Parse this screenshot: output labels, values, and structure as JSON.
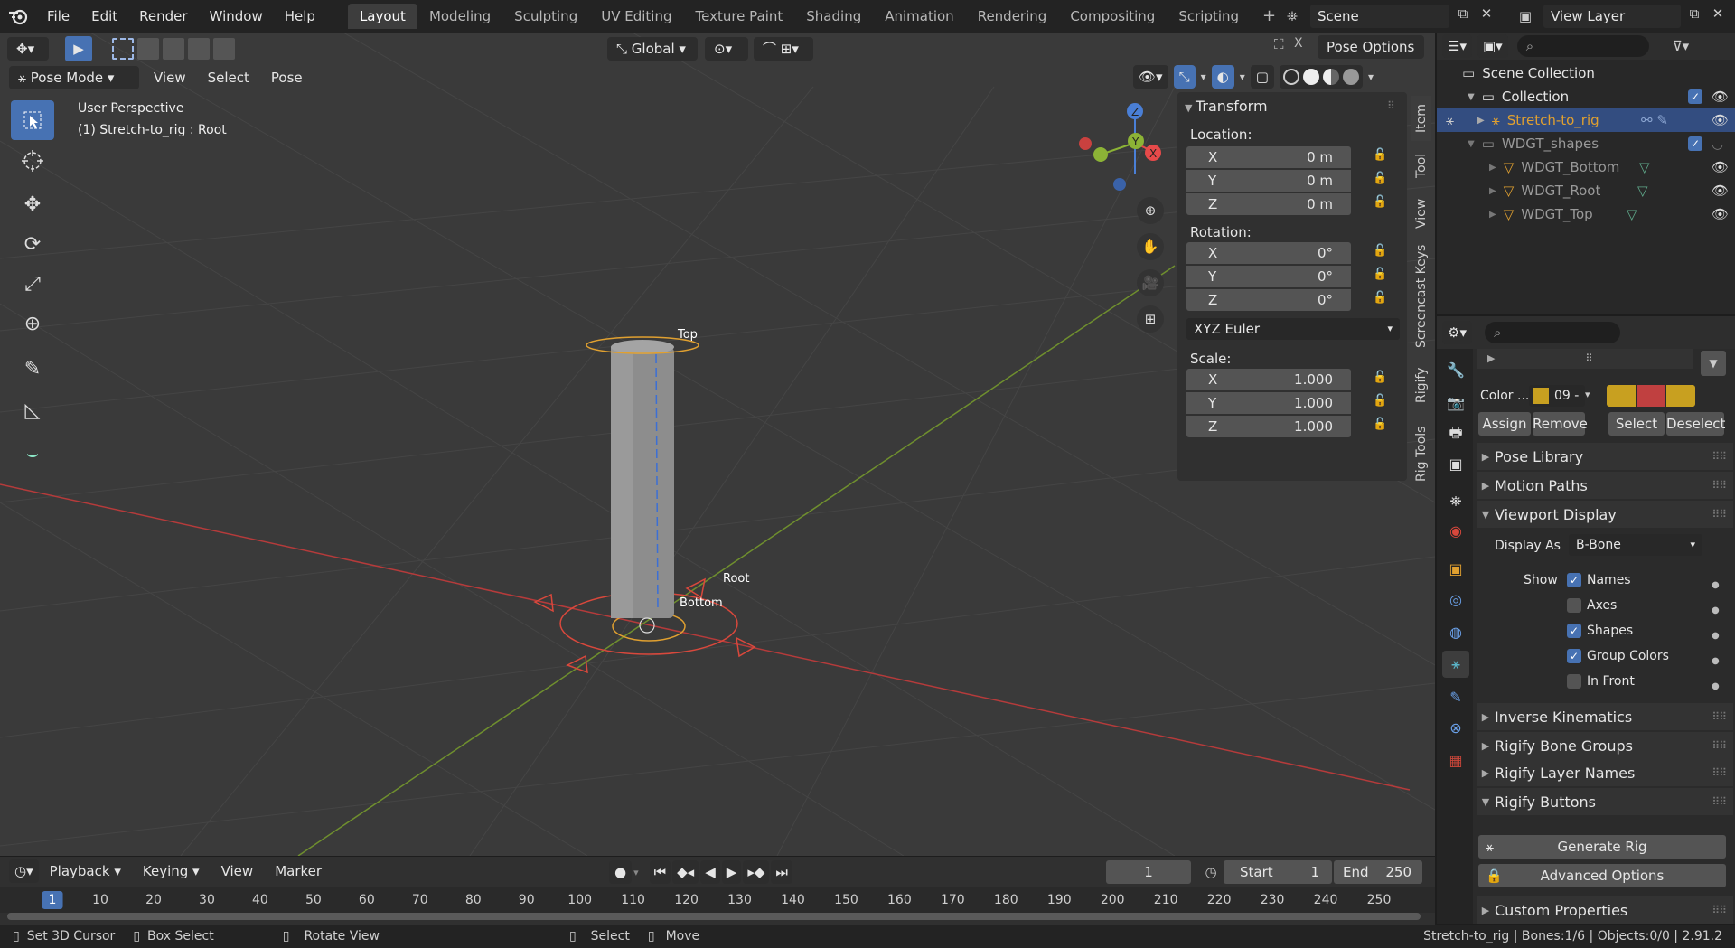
{
  "topbar": {
    "menus": [
      "File",
      "Edit",
      "Render",
      "Window",
      "Help"
    ],
    "workspaces": [
      "Layout",
      "Modeling",
      "Sculpting",
      "UV Editing",
      "Texture Paint",
      "Shading",
      "Animation",
      "Rendering",
      "Compositing",
      "Scripting"
    ],
    "active_workspace": "Layout",
    "scene": "Scene",
    "view_layer": "View Layer"
  },
  "viewport_header": {
    "transform_orientation": "Global",
    "pose_options": "Pose Options",
    "mode": "Pose Mode",
    "menus": [
      "View",
      "Select",
      "Pose"
    ]
  },
  "viewport": {
    "perspective": "User Perspective",
    "object_info": "(1) Stretch-to_rig : Root",
    "bone_labels": {
      "top": "Top",
      "root": "Root",
      "bottom": "Bottom"
    },
    "gizmo_axes": {
      "x": "X",
      "y": "Y",
      "z": "Z"
    },
    "colors": {
      "x_axis": "#e64a4a",
      "y_axis": "#8cb336",
      "z_axis": "#4a7fd6",
      "bg": "#3a3a3a",
      "selected": "#e0a030"
    }
  },
  "npanel": {
    "title": "Transform",
    "location_label": "Location:",
    "location": [
      {
        "axis": "X",
        "value": "0 m"
      },
      {
        "axis": "Y",
        "value": "0 m"
      },
      {
        "axis": "Z",
        "value": "0 m"
      }
    ],
    "rotation_label": "Rotation:",
    "rotation": [
      {
        "axis": "X",
        "value": "0°"
      },
      {
        "axis": "Y",
        "value": "0°"
      },
      {
        "axis": "Z",
        "value": "0°"
      }
    ],
    "rotation_mode": "XYZ Euler",
    "scale_label": "Scale:",
    "scale": [
      {
        "axis": "X",
        "value": "1.000"
      },
      {
        "axis": "Y",
        "value": "1.000"
      },
      {
        "axis": "Z",
        "value": "1.000"
      }
    ],
    "tabs": [
      "Item",
      "Tool",
      "View",
      "Screencast Keys",
      "Rigify",
      "Rig Tools"
    ]
  },
  "outliner": {
    "rows": [
      {
        "label": "Scene Collection"
      },
      {
        "label": "Collection"
      },
      {
        "label": "Stretch-to_rig"
      },
      {
        "label": "WDGT_shapes"
      },
      {
        "label": "WDGT_Bottom"
      },
      {
        "label": "WDGT_Root"
      },
      {
        "label": "WDGT_Top"
      }
    ]
  },
  "properties": {
    "color_label": "Color ...",
    "color_set": "09 - ",
    "assign": "Assign",
    "remove": "Remove",
    "select": "Select",
    "deselect": "Deselect",
    "panels": {
      "pose_library": "Pose Library",
      "motion_paths": "Motion Paths",
      "viewport_display": "Viewport Display",
      "inverse_kinematics": "Inverse Kinematics",
      "rigify_bone_groups": "Rigify Bone Groups",
      "rigify_layer_names": "Rigify Layer Names",
      "rigify_buttons": "Rigify Buttons",
      "custom_properties": "Custom Properties"
    },
    "display_as_label": "Display As",
    "display_as": "B-Bone",
    "show_label": "Show",
    "show_options": [
      {
        "label": "Names",
        "checked": true
      },
      {
        "label": "Axes",
        "checked": false
      },
      {
        "label": "Shapes",
        "checked": true
      },
      {
        "label": "Group Colors",
        "checked": true
      },
      {
        "label": "In Front",
        "checked": false
      }
    ],
    "generate_rig": "Generate Rig",
    "advanced_options": "Advanced Options",
    "swatch_colors": [
      "#c8a020",
      "#c04040",
      "#c8a020"
    ]
  },
  "timeline": {
    "menus": [
      "Playback",
      "Keying",
      "View",
      "Marker"
    ],
    "current_frame": "1",
    "start_label": "Start",
    "start": "1",
    "end_label": "End",
    "end": "250",
    "ticks": [
      "1",
      "10",
      "20",
      "30",
      "40",
      "50",
      "60",
      "70",
      "80",
      "90",
      "100",
      "110",
      "120",
      "130",
      "140",
      "150",
      "160",
      "170",
      "180",
      "190",
      "200",
      "210",
      "220",
      "230",
      "240",
      "250"
    ]
  },
  "statusbar": {
    "set_cursor": "Set 3D Cursor",
    "box_select": "Box Select",
    "rotate_view": "Rotate View",
    "select": "Select",
    "move": "Move",
    "info": "Stretch-to_rig | Bones:1/6 | Objects:0/0 | 2.91.2"
  }
}
